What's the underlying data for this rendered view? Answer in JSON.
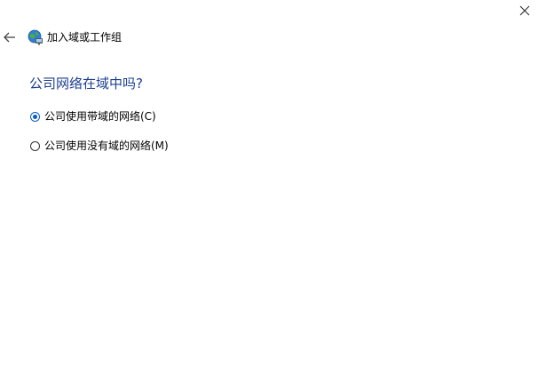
{
  "window": {
    "title": "加入域或工作组"
  },
  "icons": {
    "close": "close-icon",
    "back": "back-arrow-icon",
    "wizard": "network-globe-icon"
  },
  "page": {
    "heading": "公司网络在域中吗?"
  },
  "options": [
    {
      "label": "公司使用带域的网络(C)",
      "selected": true
    },
    {
      "label": "公司使用没有域的网络(M)",
      "selected": false
    }
  ],
  "colors": {
    "heading": "#1e3f8f",
    "radio_accent": "#0a5ec4"
  }
}
